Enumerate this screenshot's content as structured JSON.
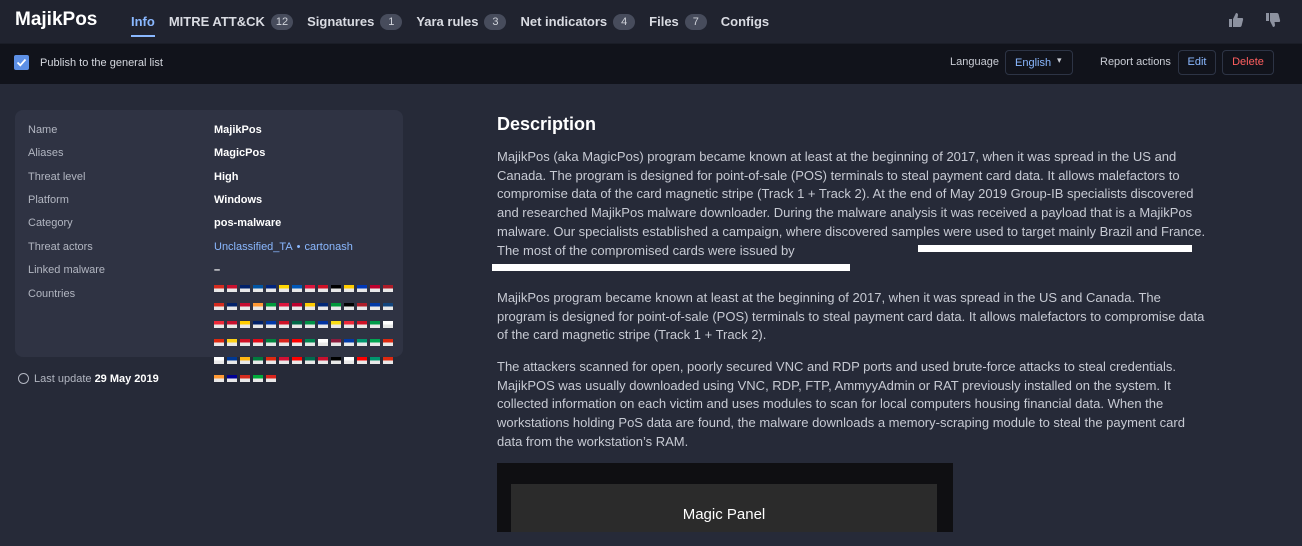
{
  "app": {
    "title": "MajikPos"
  },
  "tabs": [
    {
      "label": "Info",
      "count": null
    },
    {
      "label": "MITRE ATT&CK",
      "count": "12"
    },
    {
      "label": "Signatures",
      "count": "1"
    },
    {
      "label": "Yara rules",
      "count": "3"
    },
    {
      "label": "Net indicators",
      "count": "4"
    },
    {
      "label": "Files",
      "count": "7"
    },
    {
      "label": "Configs",
      "count": null
    }
  ],
  "toolbar": {
    "publish_label": "Publish to the general list",
    "language_label": "Language",
    "language_value": "English",
    "report_actions_label": "Report actions",
    "edit_label": "Edit",
    "delete_label": "Delete"
  },
  "info": {
    "name_label": "Name",
    "name": "MajikPos",
    "aliases_label": "Aliases",
    "aliases": "MagicPos",
    "threat_level_label": "Threat level",
    "threat_level": "High",
    "platform_label": "Platform",
    "platform": "Windows",
    "category_label": "Category",
    "category": "pos-malware",
    "threat_actors_label": "Threat actors",
    "threat_actors": [
      "Unclassified_TA",
      "cartonash"
    ],
    "linked_malware_label": "Linked malware",
    "linked_malware": "–",
    "countries_label": "Countries",
    "country_flag_colors": [
      "#d52b1e",
      "#c8102e",
      "#012169",
      "#0055a4",
      "#00247d",
      "#ffd700",
      "#0057b7",
      "#dc143c",
      "#ce1126",
      "#000000",
      "#ffcc00",
      "#0038b8",
      "#bc002d",
      "#ae1c28",
      "#d52b1e",
      "#012169",
      "#c60c30",
      "#ff9933",
      "#009c3b",
      "#dc143c",
      "#bc002d",
      "#fecb00",
      "#002776",
      "#009739",
      "#000000",
      "#ae1c28",
      "#0039a6",
      "#11457e",
      "#ed2939",
      "#c8102e",
      "#ffcc00",
      "#012169",
      "#0038a8",
      "#ce1126",
      "#006847",
      "#009246",
      "#0032a0",
      "#f9dd16",
      "#ed2939",
      "#ce1126",
      "#009a49",
      "#ffffff",
      "#de2910",
      "#fcd116",
      "#ce1126",
      "#e30a17",
      "#00843d",
      "#da251d",
      "#ff0000",
      "#008751",
      "#ffffff",
      "#8d1b3d",
      "#0039a6",
      "#00966e",
      "#00a651",
      "#de2910",
      "#ffffff",
      "#003893",
      "#ffb612",
      "#007a3d",
      "#de2910",
      "#d21034",
      "#ff0000",
      "#006a4e",
      "#c8102e",
      "#000000",
      "#ffffff",
      "#ff0000",
      "#00966e",
      "#de2910",
      "#ff9933",
      "#000095",
      "#d52b1e",
      "#00ab39",
      "#da251d"
    ]
  },
  "last_update": {
    "label": "Last update",
    "value": "29 May 2019"
  },
  "description": {
    "title": "Description",
    "p1": "MajikPos (aka MagicPos) program became known at least at the beginning of 2017, when it was spread in the US and Canada. The program is designed for point-of-sale (POS) terminals to steal payment card data. It allows malefactors to compromise data of the card magnetic stripe (Track 1 + Track 2). At the end of May 2019 Group-IB specialists discovered and researched MajikPos malware downloader. During the malware analysis it was received a payload that is a MajikPos malware. Our specialists established a campaign, where discovered samples were used to target mainly Brazil and France. The most of the compromised cards were issued by",
    "p2": "MajikPos program became known at least at the beginning of 2017, when it was spread in the US and Canada. The program is designed for point-of-sale (POS) terminals to steal payment card data. It allows malefactors to compromise data of the card magnetic stripe (Track 1 + Track 2).",
    "p3": "The attackers scanned for open, poorly secured VNC and RDP ports and used brute-force attacks to steal credentials. MajikPOS was usually downloaded using VNC, RDP, FTP, AmmyyAdmin or RAT previously installed on the system. It collected information on each victim and uses modules to scan for local computers housing financial data. When the workstations holding PoS data are found, the malware downloads a memory-scraping module to steal the payment card data from the workstation’s RAM.",
    "image_caption": "Magic Panel"
  }
}
